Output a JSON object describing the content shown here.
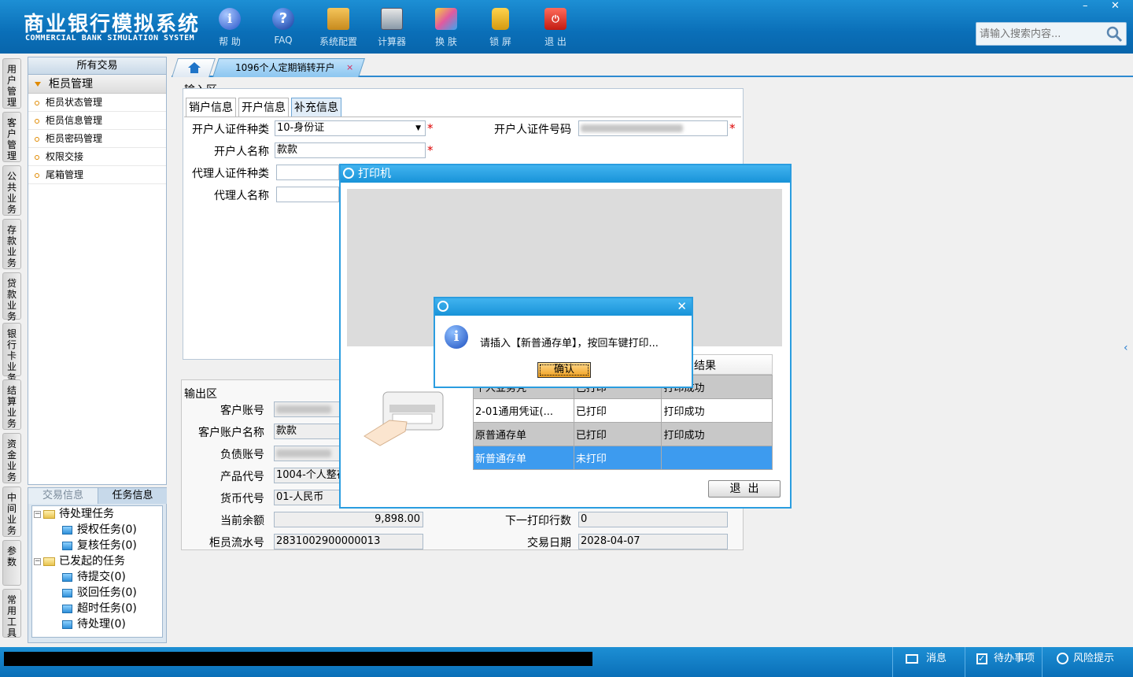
{
  "app": {
    "title_cn": "商业银行模拟系统",
    "title_en": "COMMERCIAL BANK SIMULATION SYSTEM"
  },
  "toolbar": [
    {
      "label": "帮 助",
      "icon": "help-icon"
    },
    {
      "label": "FAQ",
      "icon": "faq-icon"
    },
    {
      "label": "系统配置",
      "icon": "config-icon"
    },
    {
      "label": "计算器",
      "icon": "calculator-icon"
    },
    {
      "label": "换 肤",
      "icon": "skin-icon"
    },
    {
      "label": "锁 屏",
      "icon": "lock-icon"
    },
    {
      "label": "退 出",
      "icon": "exit-icon"
    }
  ],
  "window_controls": {
    "minimize": "–",
    "close": "✕"
  },
  "search": {
    "placeholder": "请输入搜索内容..."
  },
  "left_nav": [
    "用户管理",
    "客户管理",
    "公共业务",
    "存款业务",
    "贷款业务",
    "银行卡业务",
    "结算业务",
    "资金业务",
    "中间业务",
    "参数",
    "常用工具"
  ],
  "tree": {
    "header": "所有交易",
    "group": "柜员管理",
    "items": [
      "柜员状态管理",
      "柜员信息管理",
      "柜员密码管理",
      "权限交接",
      "尾箱管理"
    ]
  },
  "task_panel": {
    "tabs": [
      "交易信息",
      "任务信息"
    ],
    "pending": {
      "label": "待处理任务",
      "children": [
        "授权任务(0)",
        "复核任务(0)"
      ]
    },
    "initiated": {
      "label": "已发起的任务",
      "children": [
        "待提交(0)",
        "驳回任务(0)",
        "超时任务(0)",
        "待处理(0)"
      ]
    }
  },
  "tabs": {
    "current": "1096个人定期销转开户",
    "close": "×"
  },
  "input_area": {
    "title": "输入区",
    "subtabs": [
      "销户信息",
      "开户信息",
      "补充信息"
    ],
    "fields": {
      "id_type_label": "开户人证件种类",
      "id_type_value": "10-身份证",
      "id_no_label": "开户人证件号码",
      "name_label": "开户人名称",
      "name_value": "款款",
      "agent_id_type_label": "代理人证件种类",
      "agent_name_label": "代理人名称"
    }
  },
  "output_area": {
    "title": "输出区",
    "account_label": "客户账号",
    "account_name_label": "客户账户名称",
    "account_name_value": "款款",
    "debt_label": "负债账号",
    "product_label": "产品代号",
    "product_value": "1004-个人整存",
    "currency_label": "货币代号",
    "currency_value": "01-人民币",
    "balance_label": "当前余额",
    "balance_value": "9,898.00",
    "next_line_label": "下一打印行数",
    "next_line_value": "0",
    "serial_label": "柜员流水号",
    "serial_value": "2831002900000013",
    "date_label": "交易日期",
    "date_value": "2028-04-07"
  },
  "printer": {
    "title": "打印机",
    "result_header": "结果",
    "rows": [
      [
        "个人业务凭",
        "已打印",
        "打印成功"
      ],
      [
        "2-01通用凭证(...",
        "已打印",
        "打印成功"
      ],
      [
        "原普通存单",
        "已打印",
        "打印成功"
      ],
      [
        "新普通存单",
        "未打印",
        ""
      ]
    ],
    "exit_button": "退  出"
  },
  "dialog": {
    "message": "请插入【新普通存单】，按回车键打印...",
    "confirm": "确认",
    "close": "✕"
  },
  "status": {
    "message": "消息",
    "todo": "待办事项",
    "risk": "风险提示"
  }
}
